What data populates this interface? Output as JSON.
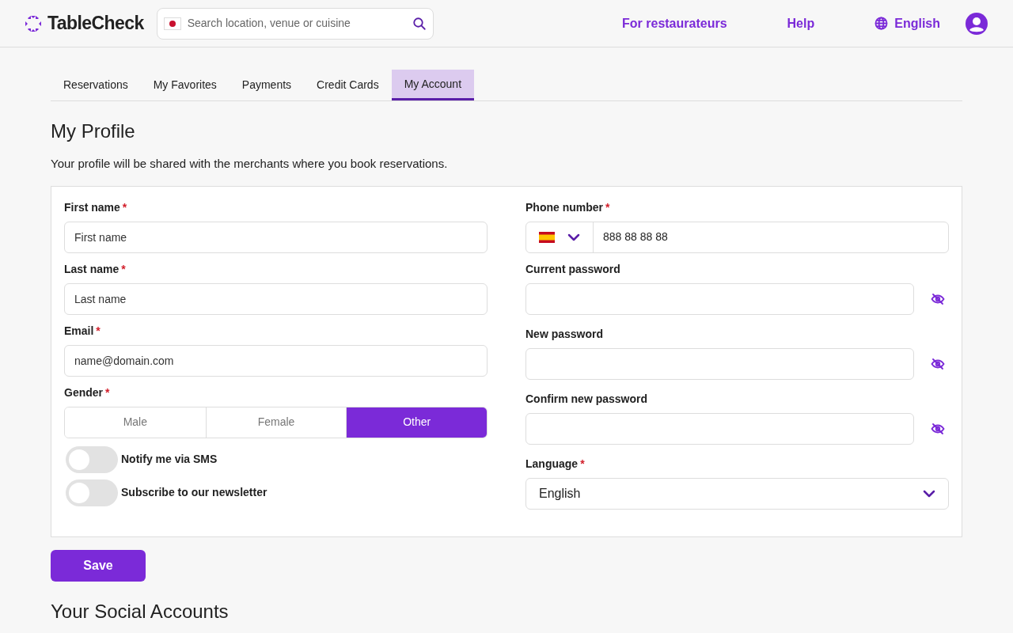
{
  "header": {
    "logo": "TableCheck",
    "search": {
      "placeholder": "Search location, venue or cuisine"
    },
    "links": [
      "For restaurateurs",
      "Help"
    ],
    "language": "English"
  },
  "tabs": [
    {
      "label": "Reservations",
      "selected": false
    },
    {
      "label": "My Favorites",
      "selected": false
    },
    {
      "label": "Payments",
      "selected": false
    },
    {
      "label": "Credit Cards",
      "selected": false
    },
    {
      "label": "My Account",
      "selected": true
    }
  ],
  "profile": {
    "title": "My Profile",
    "description": "Your profile will be shared with the merchants where you book reservations.",
    "left": [
      {
        "kind": "text",
        "label": "First name",
        "required_mark": "*",
        "placeholder": "First name"
      },
      {
        "kind": "text",
        "label": "Last name",
        "required_mark": "*",
        "placeholder": "Last name"
      },
      {
        "kind": "text",
        "label": "Email",
        "required_mark": "*",
        "placeholder": "name@domain.com"
      },
      {
        "kind": "segmented",
        "label": "Gender",
        "required_mark": "*",
        "options": [
          {
            "label": "Male",
            "selected": false
          },
          {
            "label": "Female",
            "selected": false
          },
          {
            "label": "Other",
            "selected": true
          }
        ]
      },
      {
        "kind": "toggle",
        "label": "Notify me via SMS",
        "on": false
      },
      {
        "kind": "toggle",
        "label": "Subscribe to our newsletter",
        "on": false
      }
    ],
    "right": [
      {
        "kind": "phone",
        "label": "Phone number",
        "required_mark": "*",
        "value": "888 88 88 88"
      },
      {
        "kind": "password",
        "label": "Current password"
      },
      {
        "kind": "password",
        "label": "New password"
      },
      {
        "kind": "password",
        "label": "Confirm new password"
      },
      {
        "kind": "select",
        "label": "Language",
        "required_mark": "*",
        "value": "English"
      }
    ],
    "save": "Save"
  },
  "social": {
    "title": "Your Social Accounts"
  }
}
